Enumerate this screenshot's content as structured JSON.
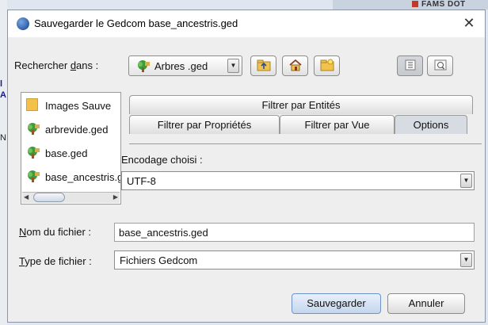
{
  "window": {
    "title": "Sauvegarder le Gedcom base_ancestris.ged",
    "close_symbol": "✕"
  },
  "lookin": {
    "label_pre": "Rechercher ",
    "label_ul": "d",
    "label_post": "ans :",
    "value": "Arbres .ged"
  },
  "toolbar": {
    "icons": [
      "up-folder-icon",
      "home-icon",
      "new-folder-icon",
      "list-view-icon",
      "details-view-icon"
    ]
  },
  "files": [
    {
      "name": "Images Sauve",
      "icon": "folder-icon"
    },
    {
      "name": "arbrevide.ged",
      "icon": "tree-icon"
    },
    {
      "name": "base.ged",
      "icon": "tree-icon"
    },
    {
      "name": "base_ancestris.ged",
      "icon": "tree-icon"
    }
  ],
  "tabs": {
    "top": "Filtrer par Entités",
    "bottom": [
      "Filtrer par Propriétés",
      "Filtrer par Vue",
      "Options"
    ],
    "active": "Options"
  },
  "options": {
    "encoding_label": "Encodage choisi :",
    "encoding_value": "UTF-8"
  },
  "filename": {
    "label_ul": "N",
    "label_post": "om du fichier :",
    "value": "base_ancestris.ged"
  },
  "filetype": {
    "label_ul": "T",
    "label_post": "ype de fichier :",
    "value": "Fichiers Gedcom"
  },
  "buttons": {
    "save": "Sauvegarder",
    "cancel": "Annuler"
  },
  "background": {
    "top_text": "FAMS DOT",
    "left_letters": [
      "l",
      "A",
      "N"
    ]
  }
}
